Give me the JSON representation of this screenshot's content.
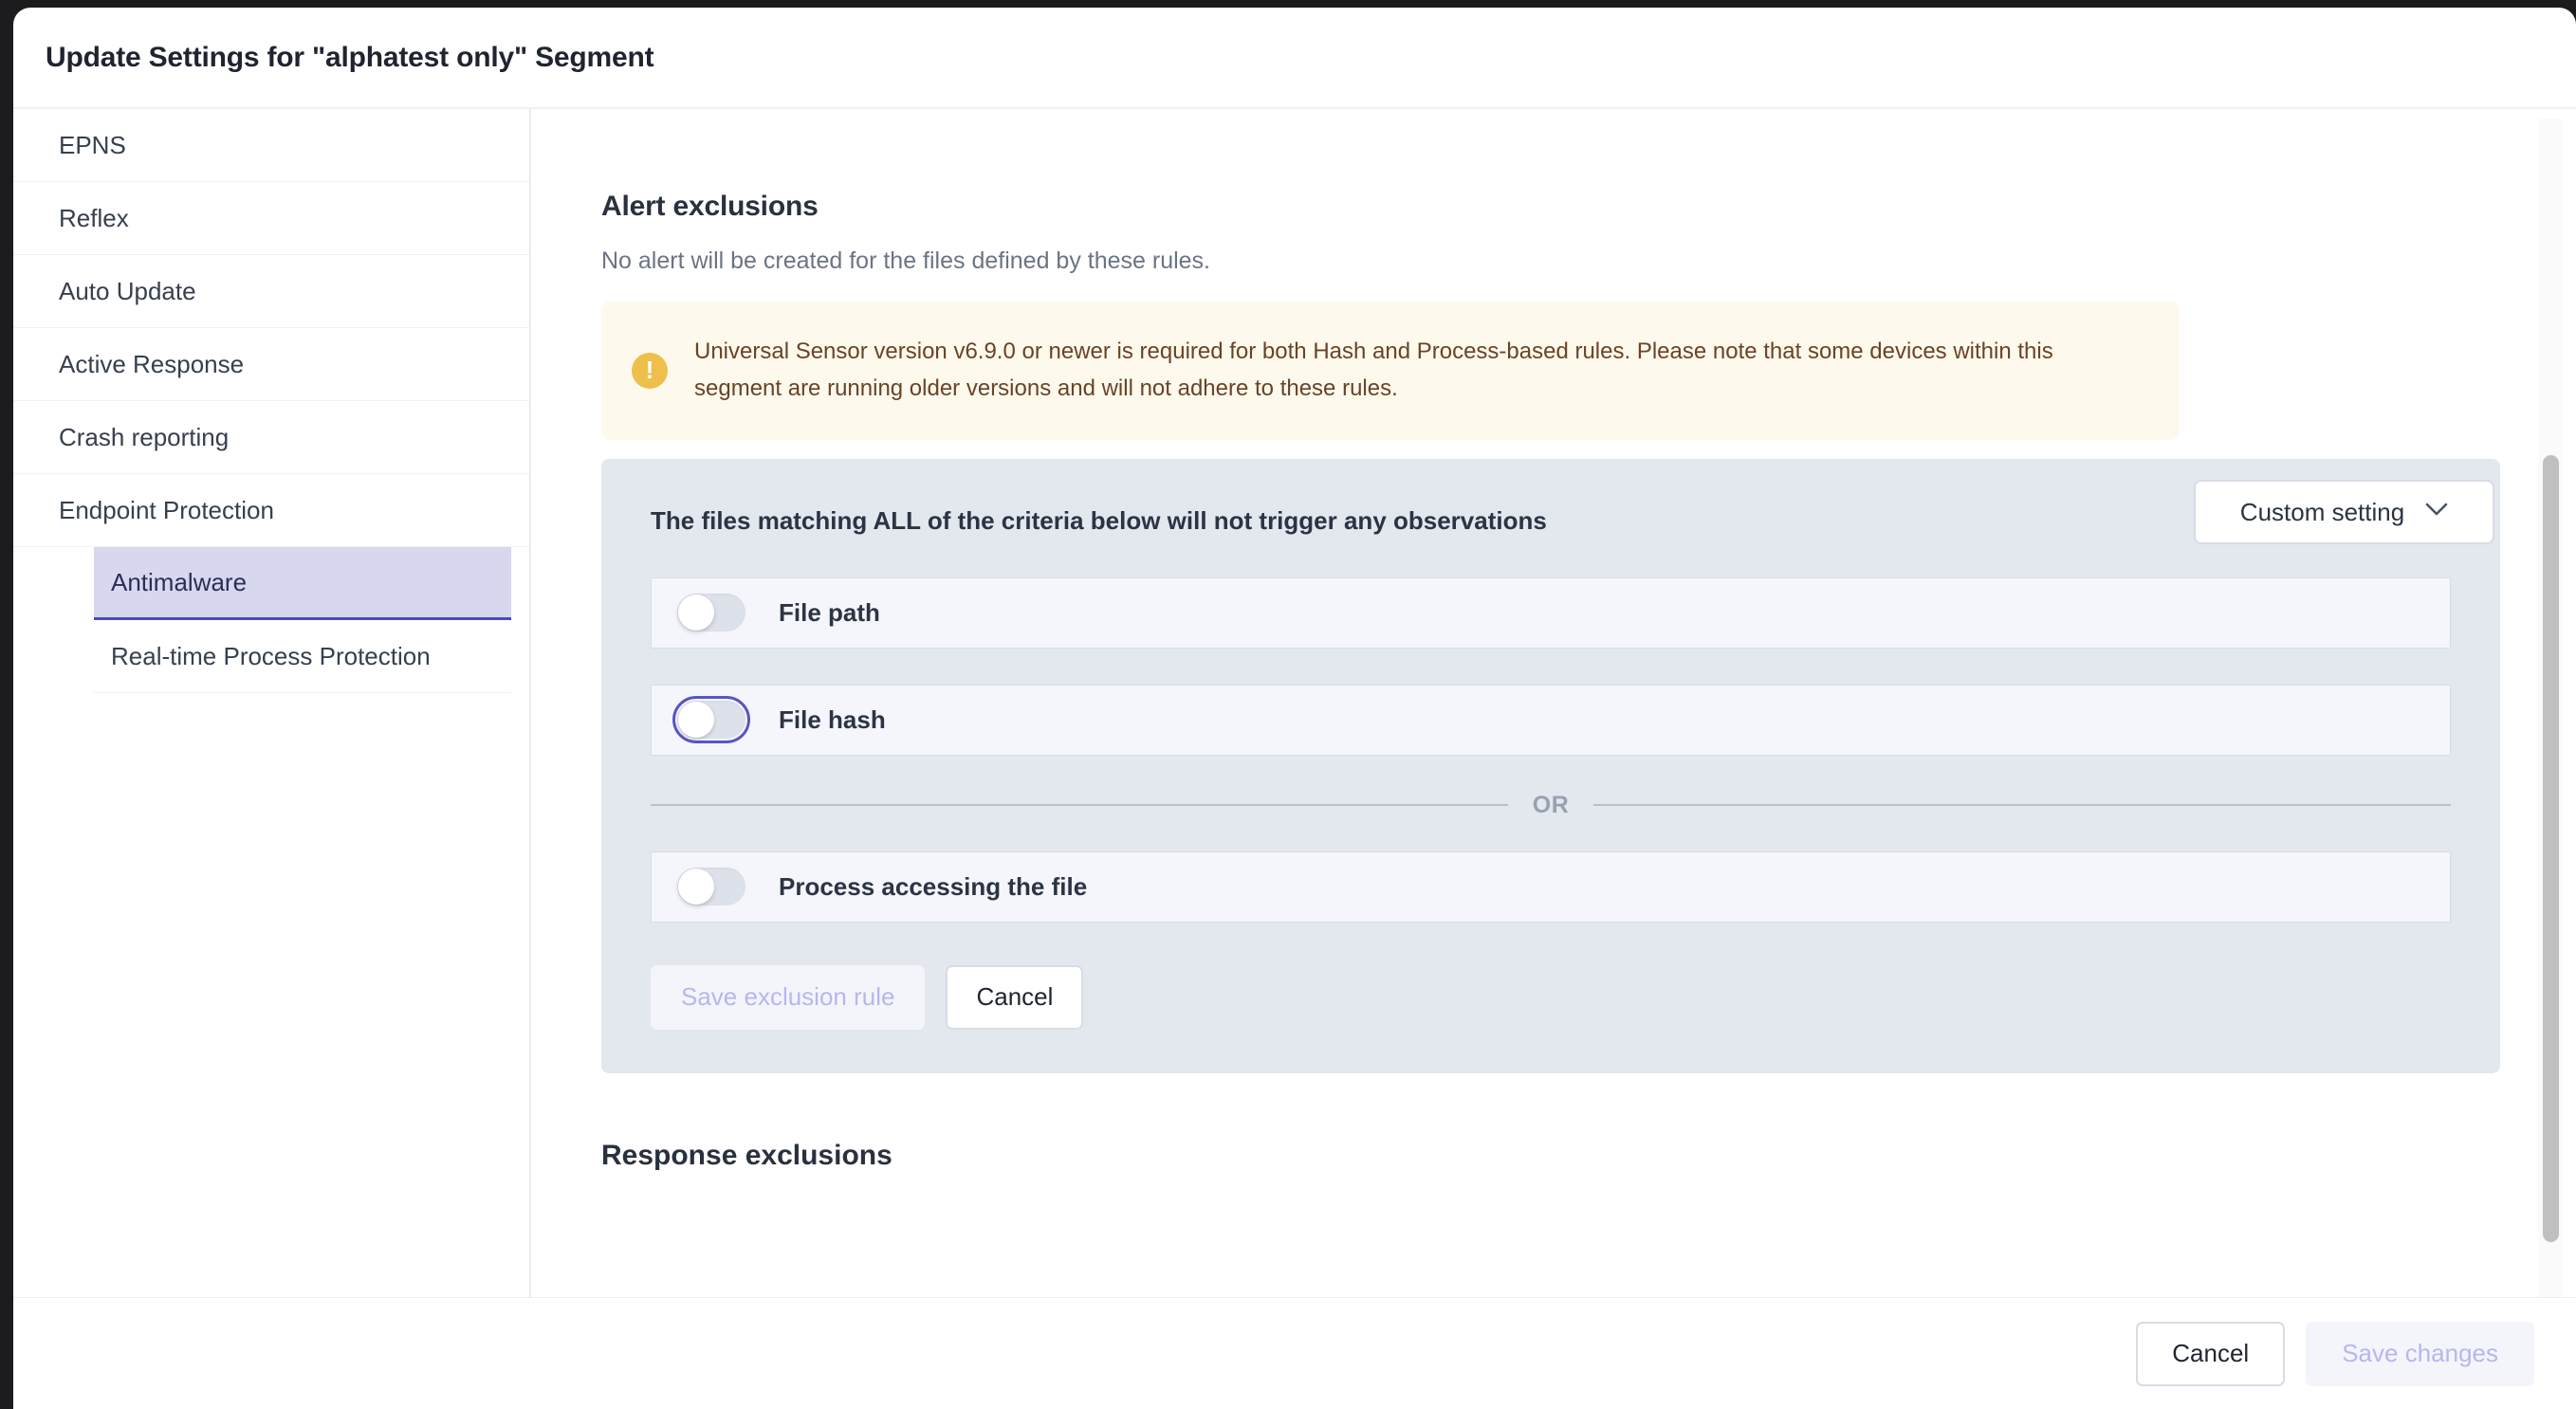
{
  "modal": {
    "title": "Update Settings for \"alphatest only\" Segment"
  },
  "sidebar": {
    "items": [
      {
        "label": "EPNS",
        "type": "top"
      },
      {
        "label": "Reflex",
        "type": "top"
      },
      {
        "label": "Auto Update",
        "type": "top"
      },
      {
        "label": "Active Response",
        "type": "top"
      },
      {
        "label": "Crash reporting",
        "type": "top"
      },
      {
        "label": "Endpoint Protection",
        "type": "top"
      },
      {
        "label": "Antimalware",
        "type": "sub",
        "active": true
      },
      {
        "label": "Real-time Process Protection",
        "type": "sub",
        "active": false
      }
    ]
  },
  "content": {
    "alert_exclusions": {
      "title": "Alert exclusions",
      "subtitle": "No alert will be created for the files defined by these rules.",
      "setting_dropdown": {
        "value": "Custom setting",
        "chevron": "chevron-down-icon"
      },
      "warning": {
        "icon": "warning-exclamation-icon",
        "text": "Universal Sensor version v6.9.0 or newer is required for both Hash and Process-based rules. Please note that some devices within this segment are running older versions and will not adhere to these rules."
      },
      "panel": {
        "title": "The files matching ALL of the criteria below will not trigger any observations",
        "rules": [
          {
            "label": "File path",
            "enabled": false,
            "focused": false
          },
          {
            "label": "File hash",
            "enabled": false,
            "focused": true
          }
        ],
        "divider_label": "OR",
        "or_rules": [
          {
            "label": "Process accessing the file",
            "enabled": false,
            "focused": false
          }
        ],
        "save_label": "Save exclusion rule",
        "cancel_label": "Cancel"
      }
    },
    "response_exclusions": {
      "title": "Response exclusions"
    }
  },
  "footer": {
    "cancel_label": "Cancel",
    "save_label": "Save changes"
  },
  "colors": {
    "accent_purple": "#4e4ab8",
    "selected_bg": "#d7d7f0",
    "warning_bg": "#fdf9ec",
    "warning_icon": "#eec04b",
    "warning_text": "#6a4326",
    "panel_bg": "#e3e7ee",
    "row_bg": "#f4f6fb",
    "disabled_text": "#b6b7ee"
  }
}
